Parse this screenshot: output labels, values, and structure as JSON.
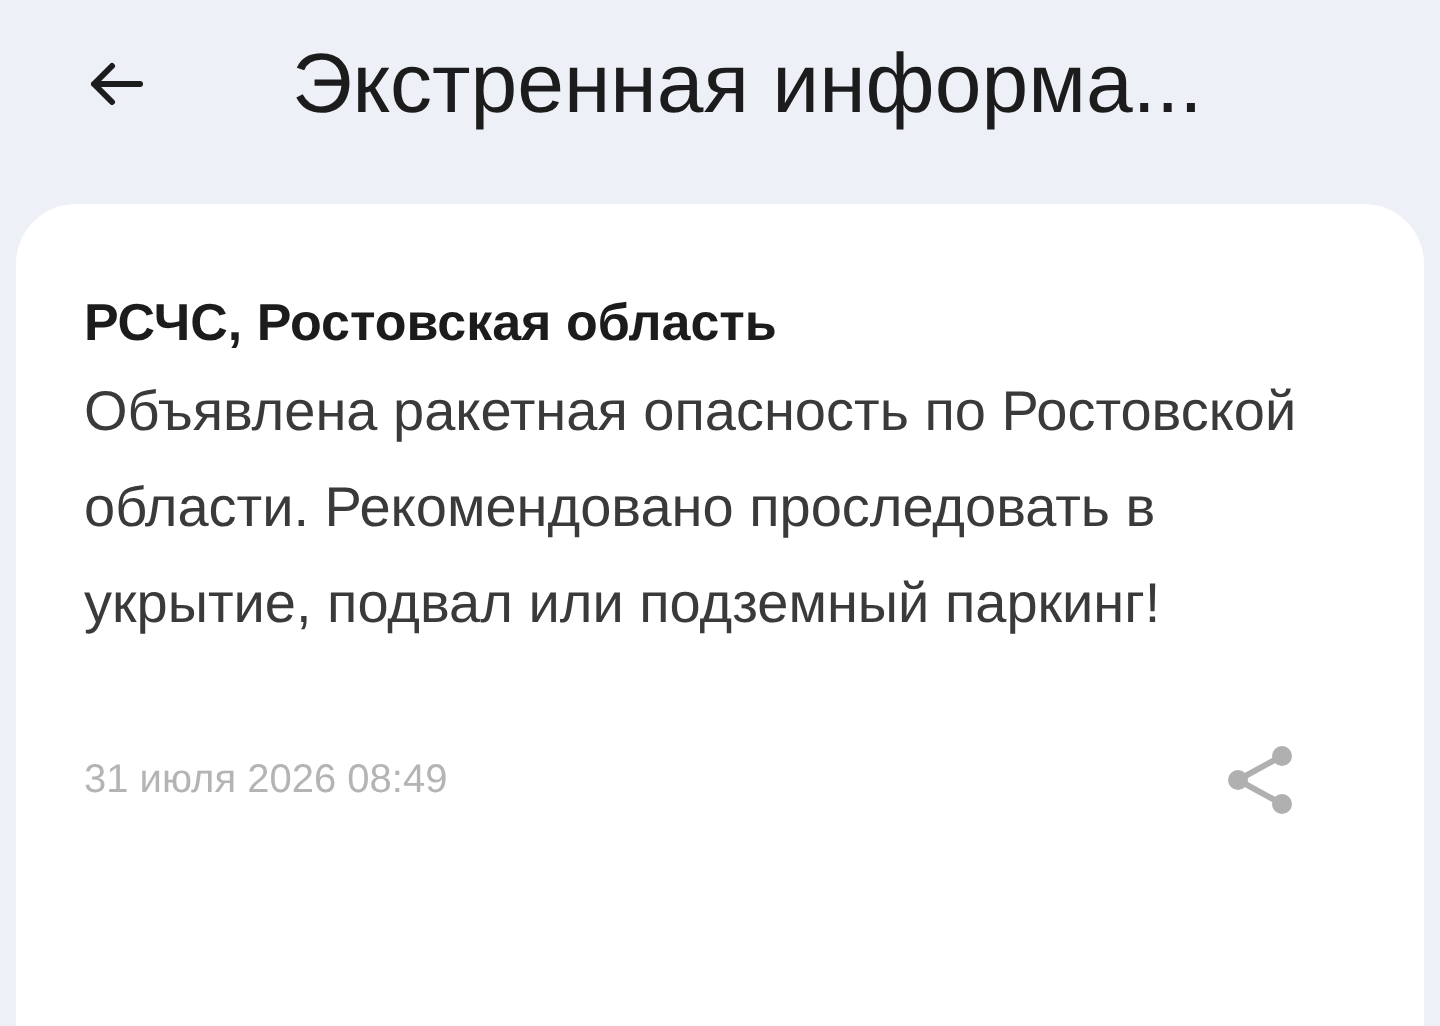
{
  "header": {
    "title": "Экстренная информа..."
  },
  "message": {
    "sender": "РСЧС, Ростовская область",
    "text": "Объявлена ракетная опасность по Ростовской области. Рекомендовано проследовать в укрытие, подвал или подземный паркинг!",
    "date": "31 июля 2026 08:49"
  }
}
